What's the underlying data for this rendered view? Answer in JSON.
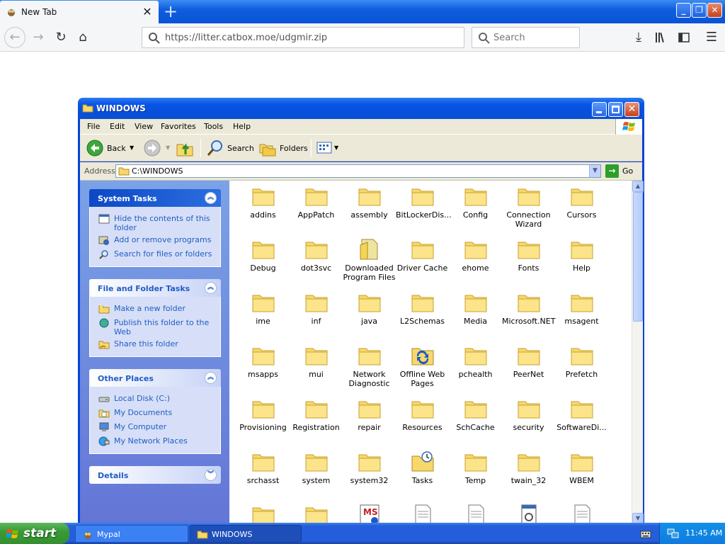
{
  "browser": {
    "tab_title": "New Tab",
    "url": "https://litter.catbox.moe/udgmir.zip",
    "search_placeholder": "Search"
  },
  "explorer": {
    "title": "WINDOWS",
    "menu": [
      "File",
      "Edit",
      "View",
      "Favorites",
      "Tools",
      "Help"
    ],
    "toolbar": {
      "back": "Back",
      "search": "Search",
      "folders": "Folders"
    },
    "address_label": "Address",
    "address": "C:\\WINDOWS",
    "go_label": "Go",
    "task_panes": [
      {
        "title": "System Tasks",
        "items": [
          "Hide the contents of this folder",
          "Add or remove programs",
          "Search for files or folders"
        ]
      },
      {
        "title": "File and Folder Tasks",
        "items": [
          "Make a new folder",
          "Publish this folder to the Web",
          "Share this folder"
        ]
      },
      {
        "title": "Other Places",
        "items": [
          "Local Disk (C:)",
          "My Documents",
          "My Computer",
          "My Network Places"
        ]
      },
      {
        "title": "Details",
        "items": []
      }
    ],
    "files": [
      "addins",
      "AppPatch",
      "assembly",
      "BitLockerDis...",
      "Config",
      "Connection Wizard",
      "Cursors",
      "Debug",
      "dot3svc",
      "Downloaded Program Files",
      "Driver Cache",
      "ehome",
      "Fonts",
      "Help",
      "ime",
      "inf",
      "java",
      "L2Schemas",
      "Media",
      "Microsoft.NET",
      "msagent",
      "msapps",
      "mui",
      "Network Diagnostic",
      "Offline Web Pages",
      "pchealth",
      "PeerNet",
      "Prefetch",
      "Provisioning",
      "Registration",
      "repair",
      "Resources",
      "SchCache",
      "security",
      "SoftwareDi...",
      "srchasst",
      "system",
      "system32",
      "Tasks",
      "Temp",
      "twain_32",
      "WBEM"
    ]
  },
  "taskbar": {
    "start_label": "start",
    "tasks": [
      "Mypal",
      "WINDOWS"
    ],
    "time": "11:45 AM"
  }
}
